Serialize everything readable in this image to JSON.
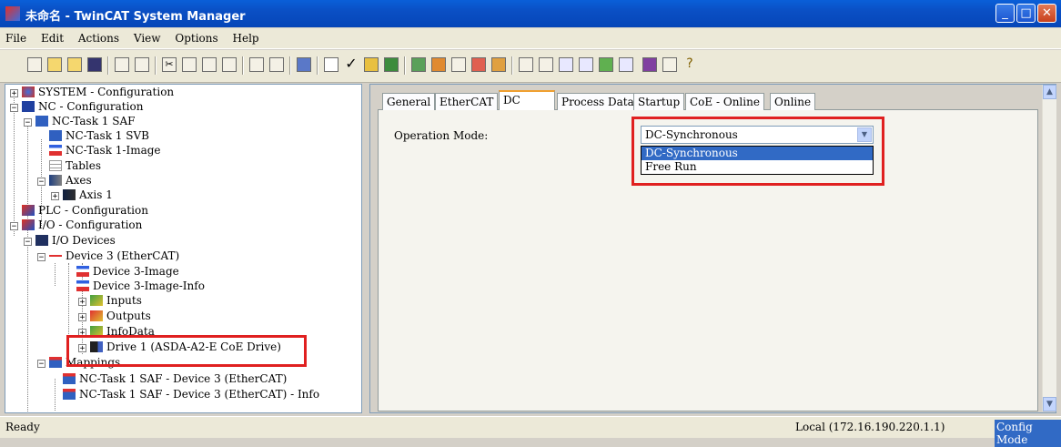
{
  "window": {
    "title": "未命名 - TwinCAT System Manager"
  },
  "menu": [
    "File",
    "Edit",
    "Actions",
    "View",
    "Options",
    "Help"
  ],
  "toolbar_icons": [
    "new-icon",
    "open-icon",
    "open-folder-icon",
    "save-icon",
    "print-icon",
    "print-preview-icon",
    "cut-icon",
    "copy-icon",
    "paste-icon",
    "paste-with-links-icon",
    "find-icon",
    "replace-icon",
    "generate-mappings-icon",
    "check-configuration-icon",
    "activate-configuration-icon",
    "restart-icon",
    "reload-devices-icon",
    "scan-devices-icon",
    "toggle-free-run-icon",
    "show-online-data-icon",
    "show-sub-items-icon",
    "zoom-icon",
    "search-icon",
    "link-variable-icon",
    "watch-icon",
    "force-icon",
    "ads-icon",
    "help-book-icon",
    "info-icon",
    "help-icon"
  ],
  "tree": {
    "system": "SYSTEM - Configuration",
    "nc": "NC - Configuration",
    "nc_task": "NC-Task 1 SAF",
    "nc_svb": "NC-Task 1 SVB",
    "nc_image": "NC-Task 1-Image",
    "tables": "Tables",
    "axes": "Axes",
    "axis1": "Axis 1",
    "plc": "PLC - Configuration",
    "io": "I/O - Configuration",
    "io_devices": "I/O Devices",
    "device3": "Device 3 (EtherCAT)",
    "device3_image": "Device 3-Image",
    "device3_image_info": "Device 3-Image-Info",
    "inputs": "Inputs",
    "outputs": "Outputs",
    "infodata": "InfoData",
    "drive1": "Drive 1 (ASDA-A2-E CoE Drive)",
    "mappings": "Mappings",
    "map1": "NC-Task 1 SAF - Device 3 (EtherCAT)",
    "map2": "NC-Task 1 SAF - Device 3 (EtherCAT) - Info"
  },
  "tabs": [
    "General",
    "EtherCAT",
    "DC",
    "Process Data",
    "Startup",
    "CoE - Online",
    "Online"
  ],
  "active_tab": "DC",
  "dc": {
    "operation_mode_label": "Operation Mode:",
    "selected": "DC-Synchronous",
    "options": [
      "DC-Synchronous",
      "Free Run"
    ]
  },
  "status": {
    "ready": "Ready",
    "local": "Local (172.16.190.220.1.1)",
    "mode": "Config Mode"
  },
  "colors": {
    "highlight": "#e02020",
    "selection": "#316ac5",
    "titlebar": "#0a4fc4",
    "active_tab_accent": "#f0a030"
  }
}
